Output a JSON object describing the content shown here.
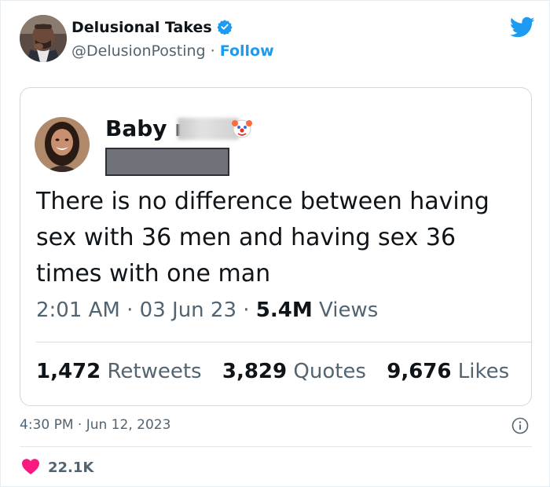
{
  "author": {
    "display_name": "Delusional Takes",
    "handle": "@DelusionPosting",
    "separator": "·",
    "follow_label": "Follow",
    "verified": true
  },
  "quoted_image": {
    "name_prefix": "Baby m",
    "text": "There is no difference between having sex with 36 men and having sex 36 times with one man",
    "time": "2:01 AM",
    "sep1": "·",
    "date": "03 Jun 23",
    "sep2": "·",
    "views_count": "5.4M",
    "views_label": "Views",
    "retweets_count": "1,472",
    "retweets_label": "Retweets",
    "quotes_count": "3,829",
    "quotes_label": "Quotes",
    "likes_count": "9,676",
    "likes_label": "Likes"
  },
  "footer": {
    "time": "4:30 PM",
    "separator": "·",
    "date": "Jun 12, 2023",
    "likes_count": "22.1K"
  },
  "colors": {
    "brand": "#1d9bf0",
    "heart": "#f91880",
    "text": "#0f1419",
    "muted": "#536471"
  },
  "icons": [
    "verified-badge-icon",
    "twitter-bird-icon",
    "info-icon",
    "heart-icon",
    "clown-emoji-icon"
  ]
}
